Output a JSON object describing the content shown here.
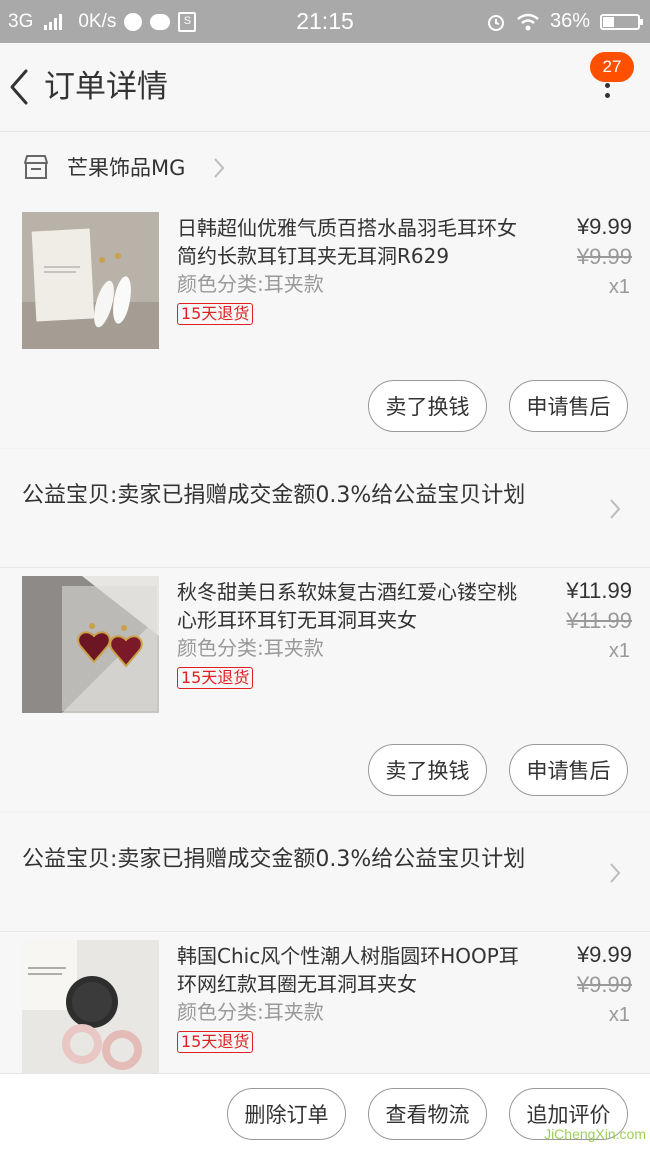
{
  "status_bar": {
    "network": "3G",
    "speed": "0K/s",
    "time": "21:15",
    "battery": "36%"
  },
  "header": {
    "title": "订单详情",
    "badge_count": "27"
  },
  "shop": {
    "name": "芒果饰品MG"
  },
  "items": [
    {
      "title": "日韩超仙优雅气质百搭水晶羽毛耳环女简约长款耳钉耳夹无耳洞R629",
      "sku": "颜色分类:耳夹款",
      "return_tag": "15天退货",
      "price": "¥9.99",
      "original_price": "¥9.99",
      "quantity": "x1",
      "btn_sell": "卖了换钱",
      "btn_aftersale": "申请售后"
    },
    {
      "title": "秋冬甜美日系软妹复古酒红爱心镂空桃心形耳环耳钉无耳洞耳夹女",
      "sku": "颜色分类:耳夹款",
      "return_tag": "15天退货",
      "price": "¥11.99",
      "original_price": "¥11.99",
      "quantity": "x1",
      "btn_sell": "卖了换钱",
      "btn_aftersale": "申请售后"
    },
    {
      "title": "韩国Chic风个性潮人树脂圆环HOOP耳环网红款耳圈无耳洞耳夹女",
      "sku": "颜色分类:耳夹款",
      "return_tag": "15天退货",
      "price": "¥9.99",
      "original_price": "¥9.99",
      "quantity": "x1"
    }
  ],
  "charity_notes": [
    "公益宝贝:卖家已捐赠成交金额0.3%给公益宝贝计划",
    "公益宝贝:卖家已捐赠成交金额0.3%给公益宝贝计划"
  ],
  "bottom_bar": {
    "delete_order": "删除订单",
    "view_logistics": "查看物流",
    "add_review": "追加评价"
  },
  "watermark": "JiChengXin.com",
  "colors": {
    "accent": "#ff5000",
    "return_tag": "#e02020",
    "status_bar": "#a9a9a9"
  }
}
